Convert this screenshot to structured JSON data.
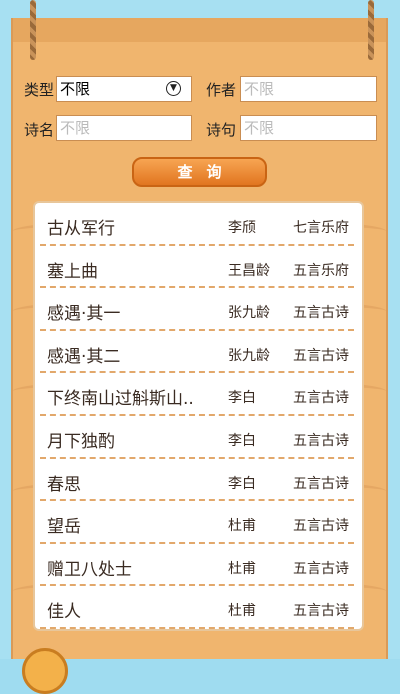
{
  "form": {
    "type_label": "类型",
    "type_value": "不限",
    "author_label": "作者",
    "author_placeholder": "不限",
    "name_label": "诗名",
    "name_placeholder": "不限",
    "line_label": "诗句",
    "line_placeholder": "不限",
    "query_button": "查询"
  },
  "poems": [
    {
      "title": "古从军行",
      "author": "李颀",
      "type": "七言乐府"
    },
    {
      "title": "塞上曲",
      "author": "王昌龄",
      "type": "五言乐府"
    },
    {
      "title": "感遇·其一",
      "author": "张九龄",
      "type": "五言古诗"
    },
    {
      "title": "感遇·其二",
      "author": "张九龄",
      "type": "五言古诗"
    },
    {
      "title": "下终南山过斛斯山..",
      "author": "李白",
      "type": "五言古诗"
    },
    {
      "title": "月下独酌",
      "author": "李白",
      "type": "五言古诗"
    },
    {
      "title": "春思",
      "author": "李白",
      "type": "五言古诗"
    },
    {
      "title": "望岳",
      "author": "杜甫",
      "type": "五言古诗"
    },
    {
      "title": "赠卫八处士",
      "author": "杜甫",
      "type": "五言古诗"
    },
    {
      "title": "佳人",
      "author": "杜甫",
      "type": "五言古诗"
    }
  ],
  "colors": {
    "board": "#f0b56e",
    "button": "#e17520",
    "sky": "#a7e0f2"
  }
}
